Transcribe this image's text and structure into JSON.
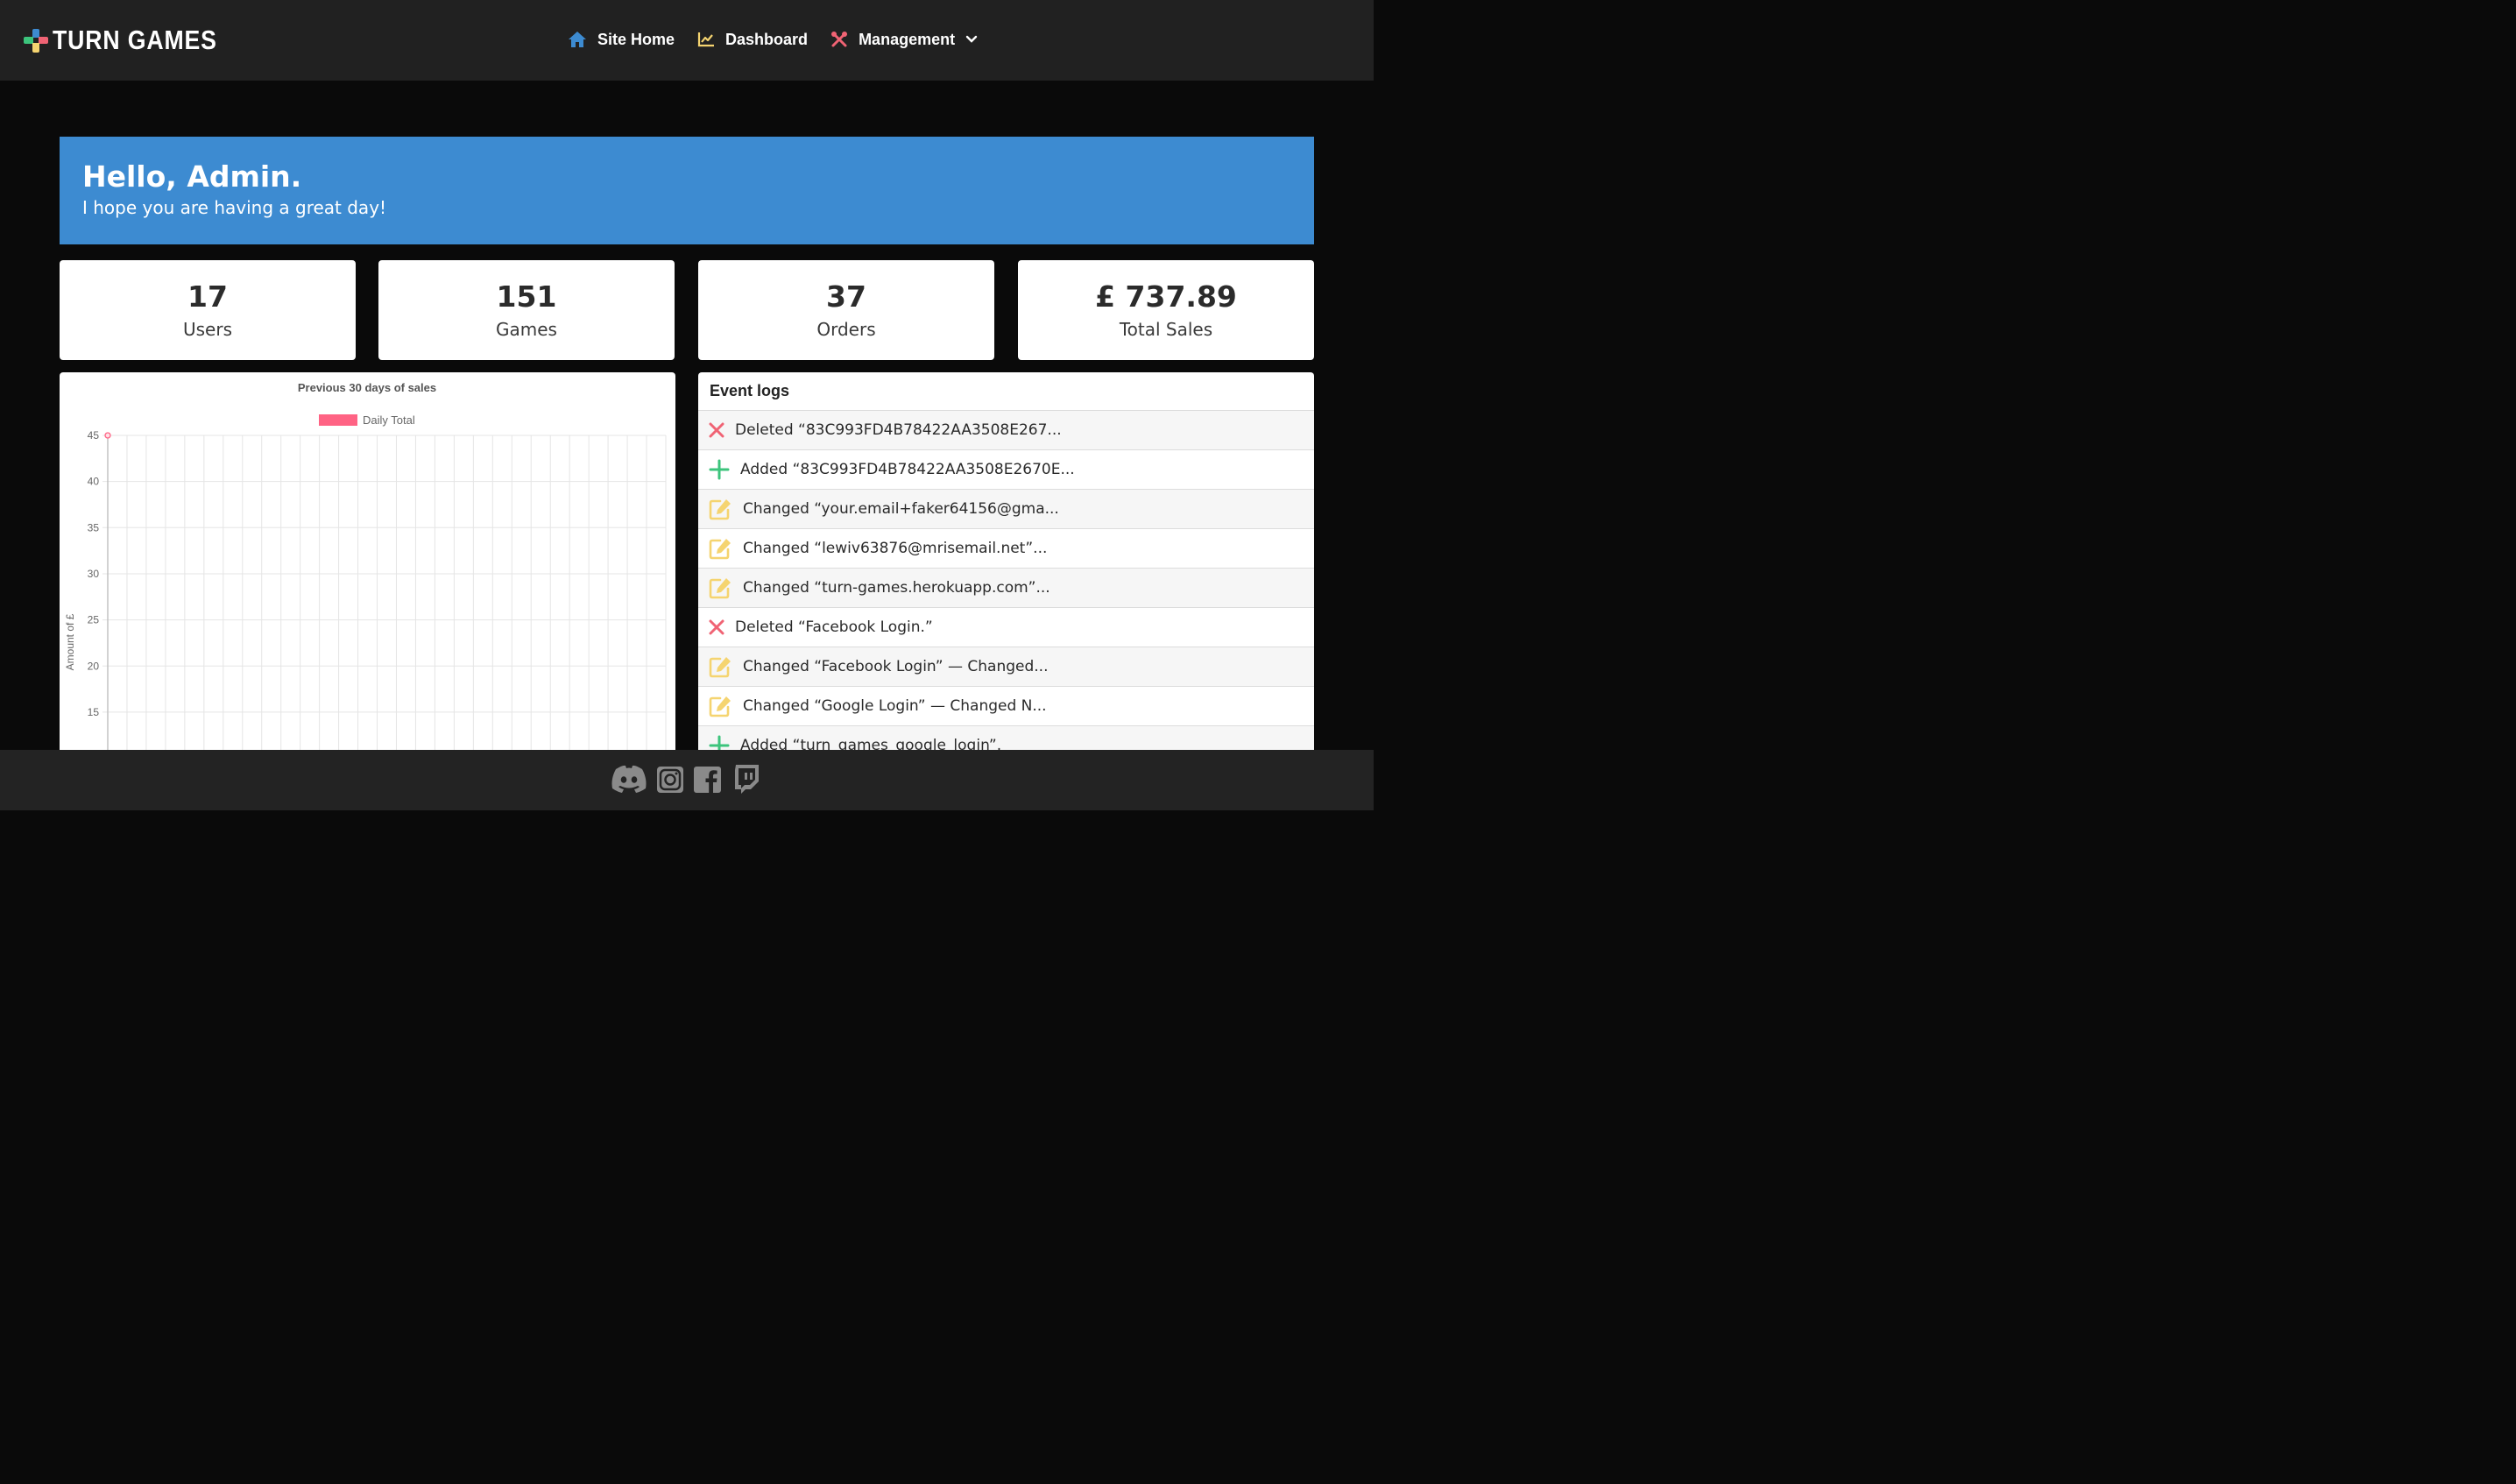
{
  "brand": {
    "name": "TURN GAMES"
  },
  "nav": {
    "items": [
      {
        "label": "Site Home",
        "icon": "home-icon",
        "color": "#3d8bd1"
      },
      {
        "label": "Dashboard",
        "icon": "chart-line-icon",
        "color": "#f5d470"
      },
      {
        "label": "Management",
        "icon": "tools-icon",
        "color": "#f06374"
      }
    ]
  },
  "hero": {
    "title": "Hello, Admin.",
    "subtitle": "I hope you are having a great day!"
  },
  "stats": [
    {
      "value": "17",
      "label": "Users"
    },
    {
      "value": "151",
      "label": "Games"
    },
    {
      "value": "37",
      "label": "Orders"
    },
    {
      "value": "£ 737.89",
      "label": "Total Sales"
    }
  ],
  "chart_data": {
    "type": "line",
    "title": "Previous 30 days of sales",
    "legend": "Daily Total",
    "legend_color": "#ff6384",
    "ylabel": "Amount of £",
    "xlabel": "",
    "yticks": [
      45,
      40,
      35,
      30,
      25,
      20,
      15
    ],
    "ylim": [
      10,
      45
    ],
    "grid": true,
    "points_visible": [
      {
        "x_index": 0,
        "y": 45
      }
    ]
  },
  "logs": {
    "title": "Event logs",
    "entries": [
      {
        "type": "deleted",
        "text": "Deleted “83C993FD4B78422AA3508E267..."
      },
      {
        "type": "added",
        "text": "Added “83C993FD4B78422AA3508E2670E..."
      },
      {
        "type": "changed",
        "text": "Changed “your.email+faker64156@gma..."
      },
      {
        "type": "changed",
        "text": "Changed “lewiv63876@mrisemail.net”..."
      },
      {
        "type": "changed",
        "text": "Changed “turn-games.herokuapp.com”..."
      },
      {
        "type": "deleted",
        "text": "Deleted “Facebook Login.”"
      },
      {
        "type": "changed",
        "text": "Changed “Facebook Login” — Changed..."
      },
      {
        "type": "changed",
        "text": "Changed “Google Login” — Changed N..."
      },
      {
        "type": "added",
        "text": "Added “turn_games_google_login”."
      }
    ]
  },
  "colors": {
    "accent": "#3d8bd1",
    "deleted": "#f06374",
    "added": "#3cc47c",
    "changed": "#f5d470"
  },
  "footer": {
    "social": [
      "discord-icon",
      "instagram-icon",
      "facebook-icon",
      "twitch-icon"
    ]
  }
}
